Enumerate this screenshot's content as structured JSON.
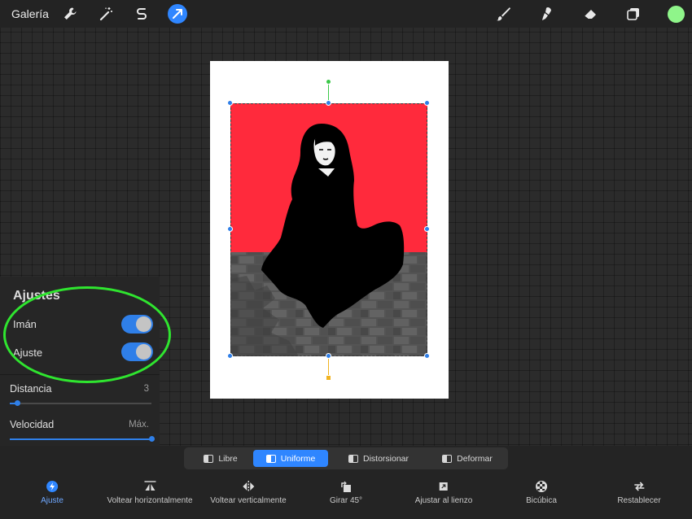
{
  "topbar": {
    "gallery_label": "Galería",
    "tools": [
      "wrench-icon",
      "magic-wand-icon",
      "selection-s-icon",
      "transform-arrow-icon"
    ],
    "right_tools": [
      "brush-icon",
      "smudge-icon",
      "eraser-icon",
      "layers-icon"
    ],
    "color": "#8ff58a",
    "accent": "#2f86ff"
  },
  "panel": {
    "title": "Ajustes",
    "toggles": [
      {
        "label": "Imán",
        "on": true
      },
      {
        "label": "Ajuste",
        "on": true
      }
    ],
    "sliders": [
      {
        "label": "Distancia",
        "value": "3",
        "fraction": 0.05
      },
      {
        "label": "Velocidad",
        "value": "Máx.",
        "fraction": 1.0
      }
    ]
  },
  "modes": {
    "items": [
      "Libre",
      "Uniforme",
      "Distorsionar",
      "Deformar"
    ],
    "selected": "Uniforme"
  },
  "actions": {
    "items": [
      {
        "label": "Ajuste",
        "icon": "snapping-icon",
        "active": true
      },
      {
        "label": "Voltear horizontalmente",
        "icon": "flip-horizontal-icon",
        "active": false
      },
      {
        "label": "Voltear verticalmente",
        "icon": "flip-vertical-icon",
        "active": false
      },
      {
        "label": "Girar 45°",
        "icon": "rotate-icon",
        "active": false
      },
      {
        "label": "Ajustar al lienzo",
        "icon": "fit-to-canvas-icon",
        "active": false
      },
      {
        "label": "Bicúbica",
        "icon": "bicubic-icon",
        "active": false
      },
      {
        "label": "Restablecer",
        "icon": "reset-icon",
        "active": false
      }
    ]
  },
  "canvas": {
    "artwork_colors": {
      "background": "#ff2a3c",
      "wall": "#5b5b5b",
      "figure": "#000000"
    },
    "annotation_color": "#2fe52f"
  }
}
